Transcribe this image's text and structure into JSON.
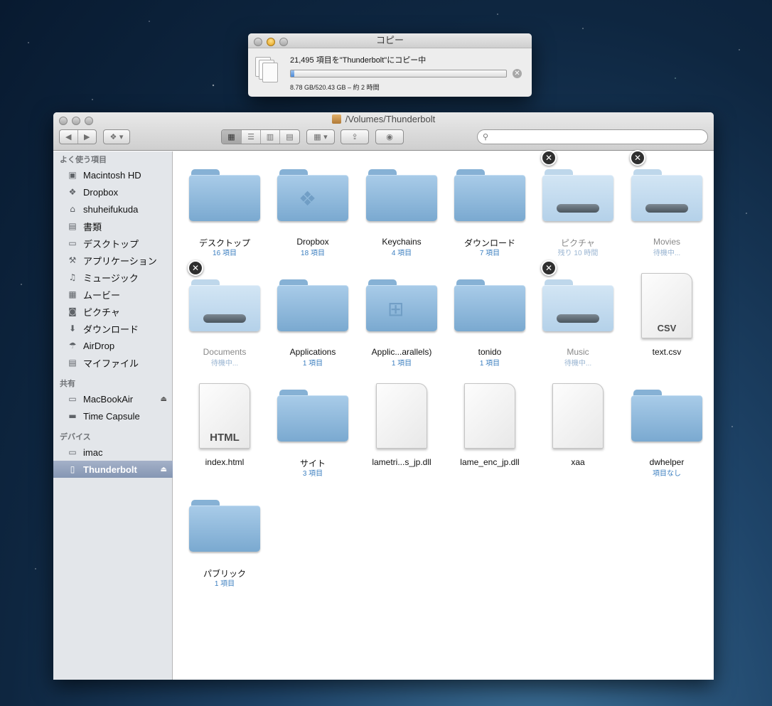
{
  "copy_dialog": {
    "title": "コピー",
    "message": "21,495 項目を\"Thunderbolt\"にコピー中",
    "progress": 0.017,
    "size_status": "8.78 GB/520.43 GB – 約 2 時間"
  },
  "finder": {
    "title": "/Volumes/Thunderbolt",
    "toolbar": {
      "back": "◀",
      "forward": "▶",
      "dropbox": "❖ ▾",
      "view_icon": "▦",
      "view_list": "☰",
      "view_column": "▥",
      "view_coverflow": "▤",
      "arrange": "▦ ▾",
      "share": "⇪",
      "quicklook": "◉",
      "search_icon": "⚲",
      "search_placeholder": ""
    },
    "sidebar": {
      "favorites_header": "よく使う項目",
      "favorites": [
        {
          "label": "Macintosh HD",
          "icon": "▣"
        },
        {
          "label": "Dropbox",
          "icon": "❖"
        },
        {
          "label": "shuheifukuda",
          "icon": "⌂"
        },
        {
          "label": "書類",
          "icon": "▤"
        },
        {
          "label": "デスクトップ",
          "icon": "▭"
        },
        {
          "label": "アプリケーション",
          "icon": "⚒"
        },
        {
          "label": "ミュージック",
          "icon": "♫"
        },
        {
          "label": "ムービー",
          "icon": "▦"
        },
        {
          "label": "ピクチャ",
          "icon": "◙"
        },
        {
          "label": "ダウンロード",
          "icon": "⬇"
        },
        {
          "label": "AirDrop",
          "icon": "☂"
        },
        {
          "label": "マイファイル",
          "icon": "▤"
        }
      ],
      "shared_header": "共有",
      "shared": [
        {
          "label": "MacBookAir",
          "icon": "▭",
          "eject": "⏏"
        },
        {
          "label": "Time Capsule",
          "icon": "▬"
        }
      ],
      "devices_header": "デバイス",
      "devices": [
        {
          "label": "imac",
          "icon": "▭"
        },
        {
          "label": "Thunderbolt",
          "icon": "▯",
          "eject": "⏏",
          "selected": true
        }
      ]
    },
    "items": [
      {
        "name": "デスクトップ",
        "sub": "16 項目",
        "kind": "folder"
      },
      {
        "name": "Dropbox",
        "sub": "18 項目",
        "kind": "folder",
        "emblem": "❖"
      },
      {
        "name": "Keychains",
        "sub": "4 項目",
        "kind": "folder"
      },
      {
        "name": "ダウンロード",
        "sub": "7 項目",
        "kind": "folder"
      },
      {
        "name": "ピクチャ",
        "sub": "残り 10 時間",
        "kind": "folder",
        "copying": true
      },
      {
        "name": "Movies",
        "sub": "待機中...",
        "kind": "folder",
        "copying": true
      },
      {
        "name": "Documents",
        "sub": "待機中...",
        "kind": "folder",
        "copying": true
      },
      {
        "name": "Applications",
        "sub": "1 項目",
        "kind": "folder"
      },
      {
        "name": "Applic...arallels)",
        "sub": "1 項目",
        "kind": "folder",
        "emblem": "⊞"
      },
      {
        "name": "tonido",
        "sub": "1 項目",
        "kind": "folder"
      },
      {
        "name": "Music",
        "sub": "待機中...",
        "kind": "folder",
        "copying": true
      },
      {
        "name": "text.csv",
        "sub": "",
        "kind": "file",
        "ext": "CSV"
      },
      {
        "name": "index.html",
        "sub": "",
        "kind": "file",
        "ext": "HTML"
      },
      {
        "name": "サイト",
        "sub": "3 項目",
        "kind": "folder"
      },
      {
        "name": "lametri...s_jp.dll",
        "sub": "",
        "kind": "file",
        "ext": ""
      },
      {
        "name": "lame_enc_jp.dll",
        "sub": "",
        "kind": "file",
        "ext": ""
      },
      {
        "name": "xaa",
        "sub": "",
        "kind": "file",
        "ext": ""
      },
      {
        "name": "dwhelper",
        "sub": "項目なし",
        "kind": "folder"
      },
      {
        "name": "パブリック",
        "sub": "1 項目",
        "kind": "folder"
      }
    ],
    "stop_glyph": "✕"
  }
}
